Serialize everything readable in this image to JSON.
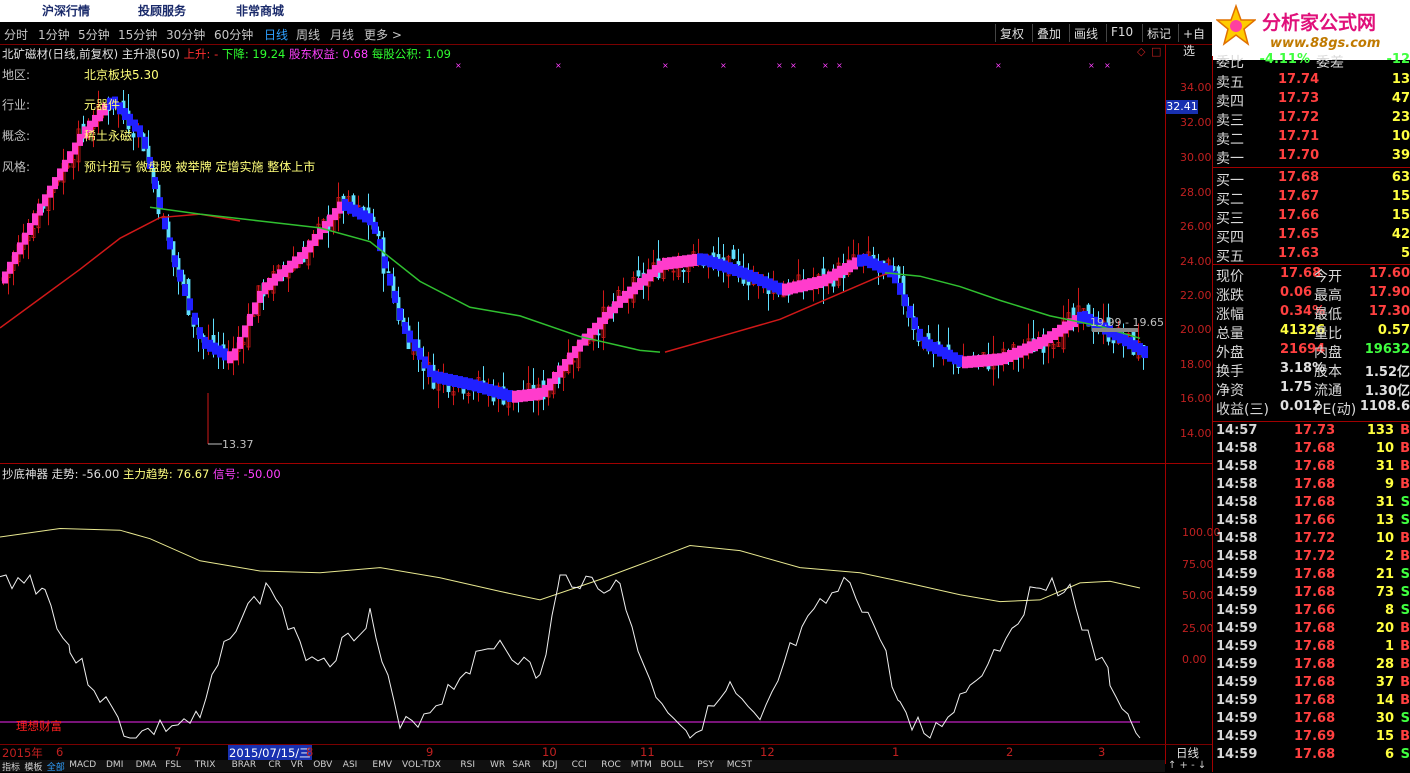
{
  "topnav": [
    "沪深行情",
    "投顾服务",
    "非常商城"
  ],
  "periods": [
    "分时",
    "1分钟",
    "5分钟",
    "15分钟",
    "30分钟",
    "60分钟",
    "日线",
    "周线",
    "月线",
    "更多 >"
  ],
  "buttons": [
    "复权",
    "叠加",
    "画线",
    "F10",
    "标记",
    "+自选"
  ],
  "logo": {
    "name": "分析家公式网",
    "url": "www.88gs.com"
  },
  "title": {
    "stock": "北矿磁材(日线,前复权)",
    "indicator": "主升浪(50)",
    "up": "上升: -",
    "down": "下降: 19.24",
    "equity": "股东权益: 0.68",
    "nav": "每股公积: 1.09"
  },
  "info": {
    "region_label": "地区:",
    "region": "北京板块5.30",
    "industry_label": "行业:",
    "industry": "元器件",
    "concept_label": "概念:",
    "concept": "稀土永磁",
    "style_label": "风格:",
    "style": "预计扭亏 微盘股 被举牌 定增实施 整体上市"
  },
  "price_axis": [
    "34.00",
    "32.00",
    "30.00",
    "28.00",
    "26.00",
    "24.00",
    "22.00",
    "20.00",
    "18.00",
    "16.00",
    "14.00"
  ],
  "current_price_tag": "32.41",
  "low_label": "13.37",
  "range_label": "19.99 - 19.65",
  "indicator": {
    "name": "抄底神器",
    "trend": "走势: -56.00",
    "main": "主力趋势: 76.67",
    "signal": "信号: -50.00"
  },
  "sub_axis": [
    "100.00",
    "75.00",
    "50.00",
    "25.00",
    "0.00"
  ],
  "sub_caption": "理想财富",
  "dates": [
    "2015年",
    "6",
    "7",
    "2015/07/15/三",
    "8",
    "9",
    "10",
    "11",
    "12",
    "1",
    "2",
    "3"
  ],
  "period_label": "日线",
  "tabs": [
    "指标",
    "模板",
    "全部",
    "MACD",
    "DMI",
    "DMA",
    "FSL",
    "TRIX",
    "BRAR",
    "CR",
    "VR",
    "OBV",
    "ASI",
    "EMV",
    "VOL-TDX",
    "RSI",
    "WR",
    "SAR",
    "KDJ",
    "CCI",
    "ROC",
    "MTM",
    "BOLL",
    "PSY",
    "MCST"
  ],
  "orderbook_top": {
    "l1": "委比",
    "v1": "-4.11%",
    "l2": "委差",
    "v2": "-12"
  },
  "asks": [
    {
      "label": "卖五",
      "price": "17.74",
      "qty": "13"
    },
    {
      "label": "卖四",
      "price": "17.73",
      "qty": "47"
    },
    {
      "label": "卖三",
      "price": "17.72",
      "qty": "23"
    },
    {
      "label": "卖二",
      "price": "17.71",
      "qty": "10"
    },
    {
      "label": "卖一",
      "price": "17.70",
      "qty": "39"
    }
  ],
  "bids": [
    {
      "label": "买一",
      "price": "17.68",
      "qty": "63"
    },
    {
      "label": "买二",
      "price": "17.67",
      "qty": "15"
    },
    {
      "label": "买三",
      "price": "17.66",
      "qty": "15"
    },
    {
      "label": "买四",
      "price": "17.65",
      "qty": "42"
    },
    {
      "label": "买五",
      "price": "17.63",
      "qty": "5"
    }
  ],
  "stats": [
    {
      "a": "现价",
      "av": "17.68",
      "b": "今开",
      "bv": "17.60"
    },
    {
      "a": "涨跌",
      "av": "0.06",
      "b": "最高",
      "bv": "17.90"
    },
    {
      "a": "涨幅",
      "av": "0.34%",
      "b": "最低",
      "bv": "17.30"
    },
    {
      "a": "总量",
      "av": "41326",
      "b": "量比",
      "bv": "0.57"
    },
    {
      "a": "外盘",
      "av": "21694",
      "b": "内盘",
      "bv": "19632"
    },
    {
      "a": "换手",
      "av": "3.18%",
      "b": "股本",
      "bv": "1.52亿"
    },
    {
      "a": "净资",
      "av": "1.75",
      "b": "流通",
      "bv": "1.30亿"
    },
    {
      "a": "收益(三)",
      "av": "0.012",
      "b": "PE(动)",
      "bv": "1108.6"
    }
  ],
  "trades": [
    {
      "t": "14:57",
      "p": "17.73",
      "n": "133",
      "s": "B"
    },
    {
      "t": "14:58",
      "p": "17.68",
      "n": "10",
      "s": "B"
    },
    {
      "t": "14:58",
      "p": "17.68",
      "n": "31",
      "s": "B"
    },
    {
      "t": "14:58",
      "p": "17.68",
      "n": "9",
      "s": "B"
    },
    {
      "t": "14:58",
      "p": "17.68",
      "n": "31",
      "s": "S"
    },
    {
      "t": "14:58",
      "p": "17.66",
      "n": "13",
      "s": "S"
    },
    {
      "t": "14:58",
      "p": "17.72",
      "n": "10",
      "s": "B"
    },
    {
      "t": "14:58",
      "p": "17.72",
      "n": "2",
      "s": "B"
    },
    {
      "t": "14:59",
      "p": "17.68",
      "n": "21",
      "s": "S"
    },
    {
      "t": "14:59",
      "p": "17.68",
      "n": "73",
      "s": "S"
    },
    {
      "t": "14:59",
      "p": "17.66",
      "n": "8",
      "s": "S"
    },
    {
      "t": "14:59",
      "p": "17.68",
      "n": "20",
      "s": "B"
    },
    {
      "t": "14:59",
      "p": "17.68",
      "n": "1",
      "s": "B"
    },
    {
      "t": "14:59",
      "p": "17.68",
      "n": "28",
      "s": "B"
    },
    {
      "t": "14:59",
      "p": "17.68",
      "n": "37",
      "s": "B"
    },
    {
      "t": "14:59",
      "p": "17.68",
      "n": "14",
      "s": "B"
    },
    {
      "t": "14:59",
      "p": "17.68",
      "n": "30",
      "s": "S"
    },
    {
      "t": "14:59",
      "p": "17.69",
      "n": "15",
      "s": "B"
    },
    {
      "t": "14:59",
      "p": "17.68",
      "n": "6",
      "s": "S"
    }
  ],
  "colors": {
    "pink": "#ff3ccc",
    "blue": "#2020ff",
    "ma_red": "#d01818",
    "ma_green": "#30c030",
    "candle_up": "#d01818",
    "candle_down": "#60e0ff",
    "buy": "#ff4040",
    "sell": "#40ff40"
  }
}
